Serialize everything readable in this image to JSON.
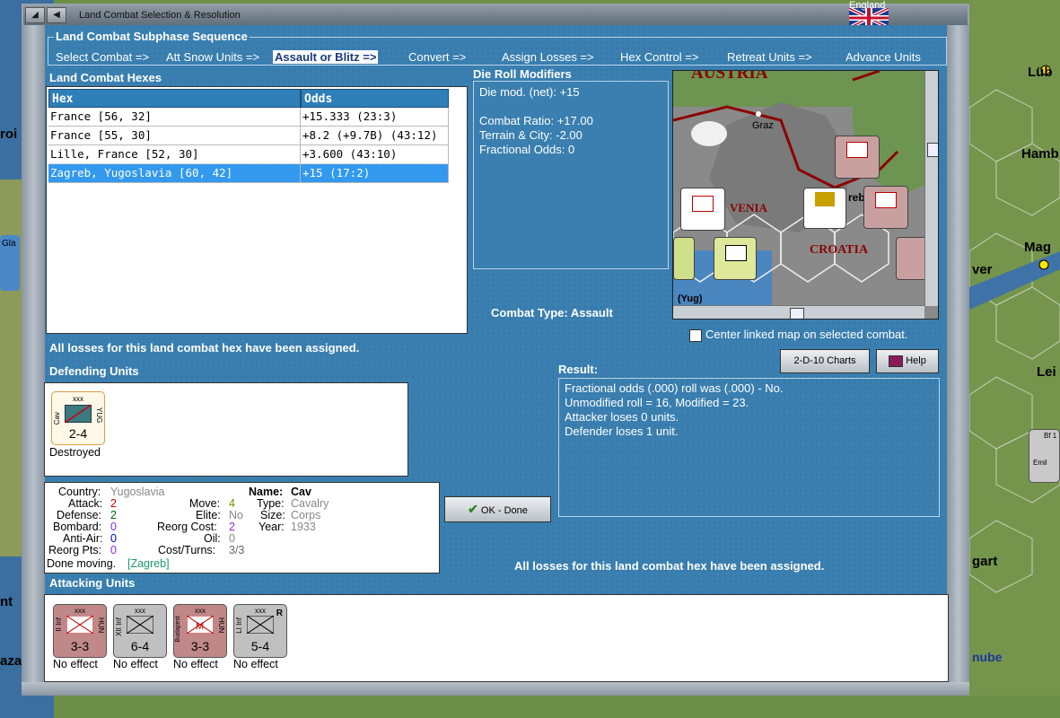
{
  "window": {
    "title": "Land Combat Selection & Resolution",
    "flag_label": "England"
  },
  "sequence": {
    "legend": "Land Combat Subphase Sequence",
    "steps": [
      "Select Combat =>",
      "Att Snow Units =>",
      "Assault or Blitz =>",
      "Convert =>",
      "Assign Losses =>",
      "Hex Control =>",
      "Retreat Units =>",
      "Advance Units"
    ],
    "active_index": 2
  },
  "hexes": {
    "title": "Land Combat Hexes",
    "col_hex": "Hex",
    "col_odds": "Odds",
    "rows": [
      {
        "hex": "France [56, 32]",
        "odds": "+15.333 (23:3)"
      },
      {
        "hex": "France [55, 30]",
        "odds": "+8.2 (+9.7B) (43:12)"
      },
      {
        "hex": "Lille, France [52, 30]",
        "odds": "+3.600 (43:10)"
      },
      {
        "hex": "Zagreb, Yugoslavia [60, 42]",
        "odds": "+15 (17:2)"
      }
    ],
    "selected_index": 3
  },
  "die_roll": {
    "title": "Die Roll Modifiers",
    "net": "Die mod. (net): +15",
    "combat_ratio": "Combat Ratio: +17.00",
    "terrain": "Terrain & City: -2.00",
    "fractional": "Fractional Odds: 0"
  },
  "combat_type": "Combat Type:  Assault",
  "map": {
    "labels": [
      "AUSTRIA",
      "Graz",
      "VENIA",
      "CROATIA",
      "(Yug)",
      "reb"
    ]
  },
  "center_linked": "Center linked map on selected combat.",
  "losses_msg": "All losses for this land combat hex have been assigned.",
  "buttons": {
    "charts": "2-D-10 Charts",
    "help": "Help",
    "ok": "OK - Done"
  },
  "defending": {
    "title": "Defending Units",
    "units": [
      {
        "top": "xxx",
        "left": "Cav",
        "right": "YUG",
        "value": "2-4",
        "status": "Destroyed"
      }
    ]
  },
  "info": {
    "country_label": "Country:",
    "country": "Yugoslavia",
    "attack_label": "Attack:",
    "attack": "2",
    "defense_label": "Defense:",
    "defense": "2",
    "bombard_label": "Bombard:",
    "bombard": "0",
    "antiair_label": "Anti-Air:",
    "antiair": "0",
    "reorgpts_label": "Reorg Pts:",
    "reorgpts": "0",
    "move_label": "Move:",
    "move": "4",
    "elite_label": "Elite:",
    "elite": "No",
    "reorgcost_label": "Reorg Cost:",
    "reorgcost": "2",
    "oil_label": "Oil:",
    "oil": "0",
    "costturns_label": "Cost/Turns:",
    "costturns": "3/3",
    "name_label": "Name:",
    "name": "Cav",
    "type_label": "Type:",
    "type": "Cavalry",
    "size_label": "Size:",
    "size": "Corps",
    "year_label": "Year:",
    "year": "1933",
    "done_label": "Done moving.",
    "done_loc": "[Zagreb]"
  },
  "result": {
    "title": "Result:",
    "lines": [
      "Fractional odds (.000) roll was (.000)  - No.",
      "Unmodified roll = 16, Modified = 23.",
      "Attacker loses 0 units.",
      "Defender loses 1 unit."
    ]
  },
  "attacking": {
    "title": "Attacking Units",
    "units": [
      {
        "top": "xxx",
        "left": "II Inf",
        "right": "HUN",
        "value": "3-3",
        "status": "No effect",
        "color": "#b87a7a"
      },
      {
        "top": "xxx",
        "left": "XII Inf",
        "right": "",
        "value": "6-4",
        "status": "No effect",
        "color": "#b5b5b5"
      },
      {
        "top": "xxx",
        "left": "Budapest",
        "right": "HUN",
        "value": "3-3",
        "status": "No effect",
        "color": "#b87a7a"
      },
      {
        "top": "xxx",
        "left": "LI Inf",
        "right": "R",
        "value": "5-4",
        "status": "No effect",
        "color": "#b5b5b5"
      }
    ]
  },
  "bg_labels": [
    "Lüb",
    "Hamb",
    "Mag",
    "ver",
    "Lei",
    "gart",
    "nube",
    "roi",
    "Gla",
    "nt",
    "aza",
    "Bf 1",
    "Emil"
  ],
  "colors": {
    "panel": "#3a7fb0",
    "header_blue": "#2f7fb8",
    "selected_row": "#3399ee"
  }
}
